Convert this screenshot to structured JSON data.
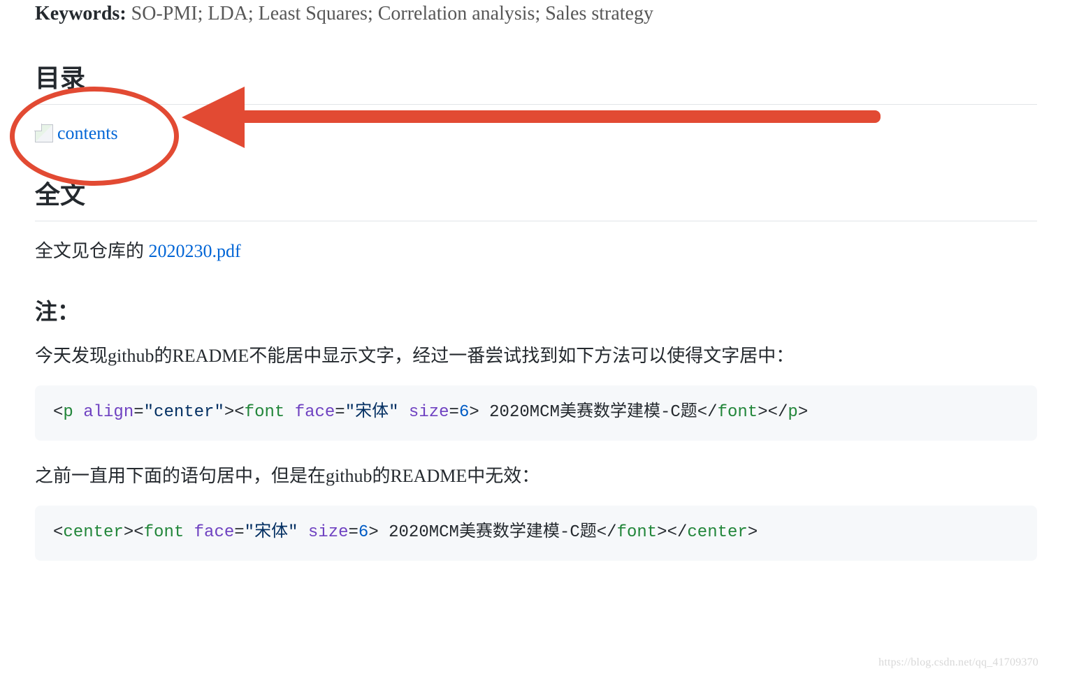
{
  "keywords": {
    "label": "Keywords:",
    "value": "SO-PMI; LDA; Least Squares; Correlation analysis; Sales strategy"
  },
  "sections": {
    "toc_heading": "目录",
    "fulltext_heading": "全文",
    "note_heading": "注："
  },
  "broken_image_alt": "contents",
  "fulltext": {
    "prefix": "全文见仓库的 ",
    "link_text": "2020230.pdf"
  },
  "note_paragraph_1": "今天发现github的README不能居中显示文字，经过一番尝试找到如下方法可以使得文字居中：",
  "note_paragraph_2": "之前一直用下面的语句居中，但是在github的README中无效：",
  "code1": {
    "tag_p": "p",
    "attr_align": "align",
    "val_center": "\"center\"",
    "tag_font": "font",
    "attr_face": "face",
    "val_face": "\"宋体\"",
    "attr_size": "size",
    "val_size": "6",
    "inner_text": " 2020MCM美赛数学建模-C题"
  },
  "code2": {
    "tag_center": "center",
    "tag_font": "font",
    "attr_face": "face",
    "val_face": "\"宋体\"",
    "attr_size": "size",
    "val_size": "6",
    "inner_text": " 2020MCM美赛数学建模-C题"
  },
  "watermark": "https://blog.csdn.net/qq_41709370",
  "annotation": {
    "circle_label": "highlight-circle",
    "arrow_label": "highlight-arrow"
  }
}
